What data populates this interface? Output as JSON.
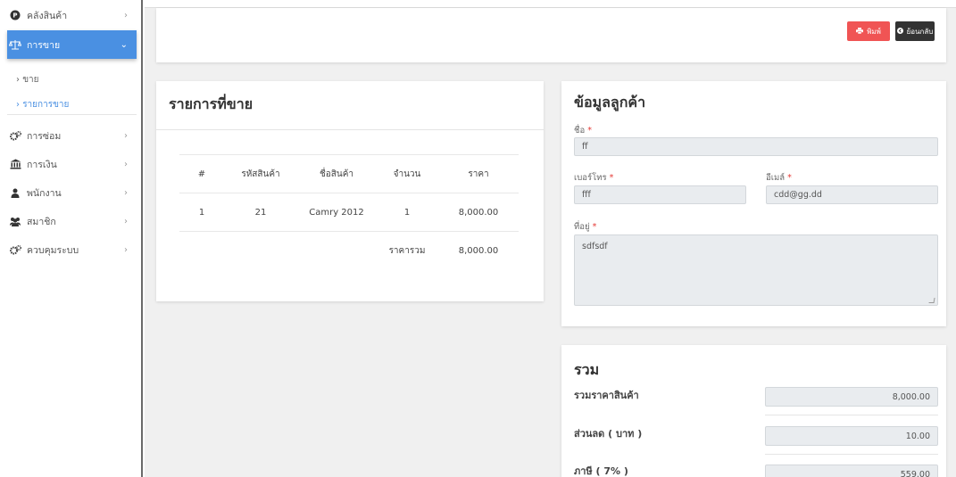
{
  "sidebar": {
    "items": [
      {
        "label": "คลังสินค้า",
        "icon": "product-icon"
      },
      {
        "label": "การขาย",
        "icon": "scale-icon"
      },
      {
        "label": "การซ่อม",
        "icon": "gears-icon"
      },
      {
        "label": "การเงิน",
        "icon": "bank-icon"
      },
      {
        "label": "พนักงาน",
        "icon": "user-icon"
      },
      {
        "label": "สมาชิก",
        "icon": "users-icon"
      },
      {
        "label": "ควบคุมระบบ",
        "icon": "gears-icon"
      }
    ],
    "sub_items": [
      {
        "label": "ขาย"
      },
      {
        "label": "รายการขาย"
      }
    ]
  },
  "toolbar": {
    "print_label": "พิมพ์",
    "back_label": "ย้อนกลับ"
  },
  "sale_list": {
    "title": "รายการที่ขาย",
    "headers": [
      "#",
      "รหัสสินค้า",
      "ชื่อสินค้า",
      "จำนวน",
      "ราคา"
    ],
    "rows": [
      {
        "no": "1",
        "code": "21",
        "name": "Camry 2012",
        "qty": "1",
        "price": "8,000.00"
      }
    ],
    "total_label": "ราคารวม",
    "total_value": "8,000.00"
  },
  "customer": {
    "title": "ข้อมูลลูกค้า",
    "name_label": "ชื่อ",
    "name_value": "ff",
    "phone_label": "เบอร์โทร",
    "phone_value": "fff",
    "email_label": "อีเมล์",
    "email_value": "cdd@gg.dd",
    "address_label": "ที่อยู่",
    "address_value": "sdfsdf",
    "required_mark": "*"
  },
  "summary": {
    "title": "รวม",
    "subtotal_label": "รวมราคาสินค้า",
    "subtotal_value": "8,000.00",
    "discount_label": "ส่วนลด ( บาท )",
    "discount_value": "10.00",
    "vat_label": "ภาษี ( 7% )",
    "vat_value": "559.00"
  },
  "colors": {
    "accent": "#4a90e2",
    "print_button": "#f05454",
    "back_button": "#333333",
    "required": "#e53935"
  }
}
